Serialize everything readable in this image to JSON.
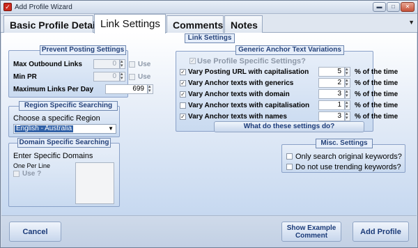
{
  "window": {
    "title": "Add Profile Wizard",
    "icon": "app-icon"
  },
  "tabs": [
    {
      "label": "Basic Profile Details"
    },
    {
      "label": "Link Settings"
    },
    {
      "label": "Comments"
    },
    {
      "label": "Notes"
    }
  ],
  "main": {
    "caption": "Link Settings"
  },
  "prevent": {
    "title": "Prevent Posting Settings",
    "max_outbound_label": "Max Outbound Links",
    "max_outbound_value": "0",
    "min_pr_label": "Min PR",
    "min_pr_value": "0",
    "use_label": "Use",
    "max_links_label": "Maximum Links Per Day",
    "max_links_value": "699"
  },
  "region": {
    "title": "Region Specific Searching",
    "choose_label": "Choose a specific Region",
    "selected": "English - Australia"
  },
  "domain": {
    "title": "Domain Specific Searching",
    "enter_label": "Enter Specific Domains",
    "per_line_label": "One Per Line",
    "use_label": "Use ?"
  },
  "generic": {
    "title": "Generic Anchor Text Variations",
    "use_profile_label": "Use Profile Specific Settings?",
    "suffix": "% of the time",
    "rows": [
      {
        "label": "Vary Posting URL with capitalisation",
        "checked": true,
        "value": "5"
      },
      {
        "label": "Vary Anchor texts with generics",
        "checked": true,
        "value": "2"
      },
      {
        "label": "Vary Anchor texts with domain",
        "checked": true,
        "value": "3"
      },
      {
        "label": "Vary Anchor texts with capitalisation",
        "checked": false,
        "value": "1"
      },
      {
        "label": "Vary Anchor texts with names",
        "checked": true,
        "value": "3"
      }
    ],
    "help_button": "What do these settings do?"
  },
  "misc": {
    "title": "Misc. Settings",
    "only_original_label": "Only search original keywords?",
    "no_trending_label": "Do not use trending keywords?"
  },
  "footer": {
    "cancel": "Cancel",
    "show_example_line1": "Show Example",
    "show_example_line2": "Comment",
    "add_profile": "Add Profile"
  },
  "colors": {
    "accent": "#25427a",
    "selection": "#3262a8",
    "close_button": "#c6523a"
  }
}
